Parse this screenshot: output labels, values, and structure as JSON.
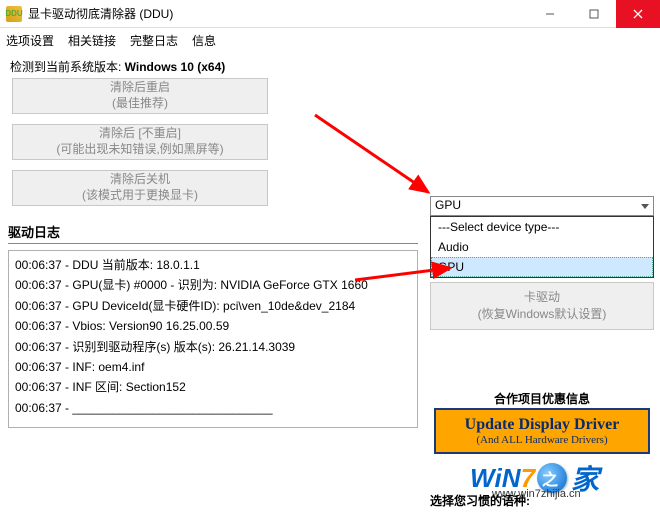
{
  "titlebar": {
    "title": "显卡驱动彻底清除器 (DDU)"
  },
  "menubar": {
    "items": [
      "选项设置",
      "相关链接",
      "完整日志",
      "信息"
    ]
  },
  "sys": {
    "prefix": "检测到当前系统版本: ",
    "value": "Windows 10 (x64)"
  },
  "buttons": {
    "b1_l1": "清除后重启",
    "b1_l2": "(最佳推荐)",
    "b2_l1": "清除后 [不重启]",
    "b2_l2": "(可能出现未知错误,例如黑屏等)",
    "b3_l1": "清除后关机",
    "b3_l2": "(该模式用于更换显卡)"
  },
  "log": {
    "title": "驱动日志",
    "lines": [
      "00:06:37 - DDU 当前版本: 18.0.1.1",
      "00:06:37 - GPU(显卡) #0000 - 识别为: NVIDIA GeForce GTX 1660",
      "00:06:37 - GPU DeviceId(显卡硬件ID): pci\\ven_10de&dev_2184",
      "00:06:37 - Vbios: Version90 16.25.00.59",
      "00:06:37 - 识别到驱动程序(s) 版本(s): 26.21.14.3039",
      "00:06:37 - INF: oem4.inf",
      "00:06:37 - INF 区间: Section152",
      "00:06:37 - ______________________________"
    ]
  },
  "dropdown": {
    "selected": "GPU",
    "options": [
      "---Select device type---",
      "Audio",
      "GPU"
    ]
  },
  "behind_btn": {
    "l1": "卡驱动",
    "l2": "(恢复Windows默认设置)"
  },
  "ad": {
    "title": "合作项目优惠信息",
    "l1": "Update Display Driver",
    "l2": "(And ALL Hardware Drivers)"
  },
  "watermark": {
    "w": "W",
    "i": "i",
    "n": "N",
    "seven": "7",
    "jia": "家",
    "url": "www.win7zhijia.cn"
  },
  "lang_label": "选择您习惯的语种:"
}
